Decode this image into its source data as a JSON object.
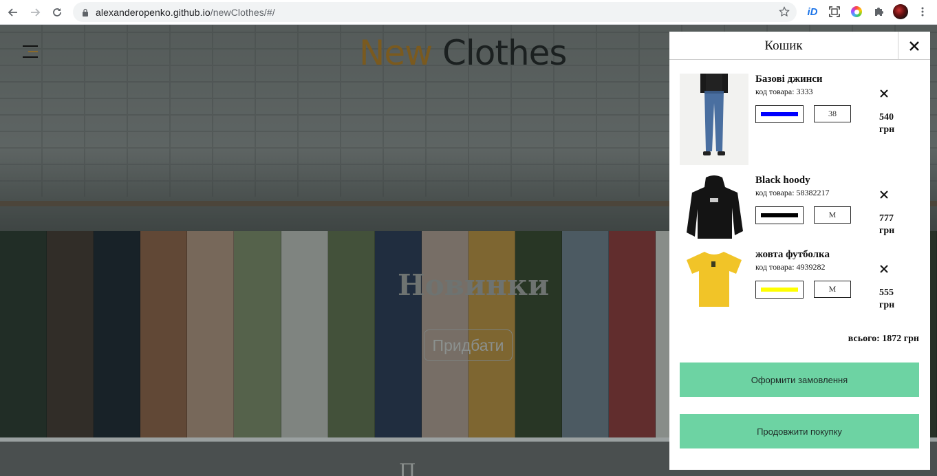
{
  "browser": {
    "url_host": "alexanderopenko.github.io",
    "url_path": "/newClothes/#/"
  },
  "site": {
    "logo_part1": "New",
    "logo_part2": "Clothes",
    "hero_title": "Новинки",
    "hero_button": "Придбати",
    "section_title_partial": "П"
  },
  "cart": {
    "title": "Кошик",
    "items": [
      {
        "name": "Базові джинси",
        "code": "код товара: 3333",
        "color": "#0000ff",
        "size": "38",
        "price": "540 грн"
      },
      {
        "name": "Black hoody",
        "code": "код товара: 58382217",
        "color": "#000000",
        "size": "M",
        "price": "777 грн"
      },
      {
        "name": "жовта футболка",
        "code": "код товара: 4939282",
        "color": "#ffff00",
        "size": "M",
        "price": "555 грн"
      }
    ],
    "total": "всього: 1872 грн",
    "checkout_label": "Оформити замовлення",
    "continue_label": "Продовжити покупку"
  },
  "colors": {
    "accent_green": "#6dd3a3",
    "logo_gold": "#7a5a1f"
  }
}
